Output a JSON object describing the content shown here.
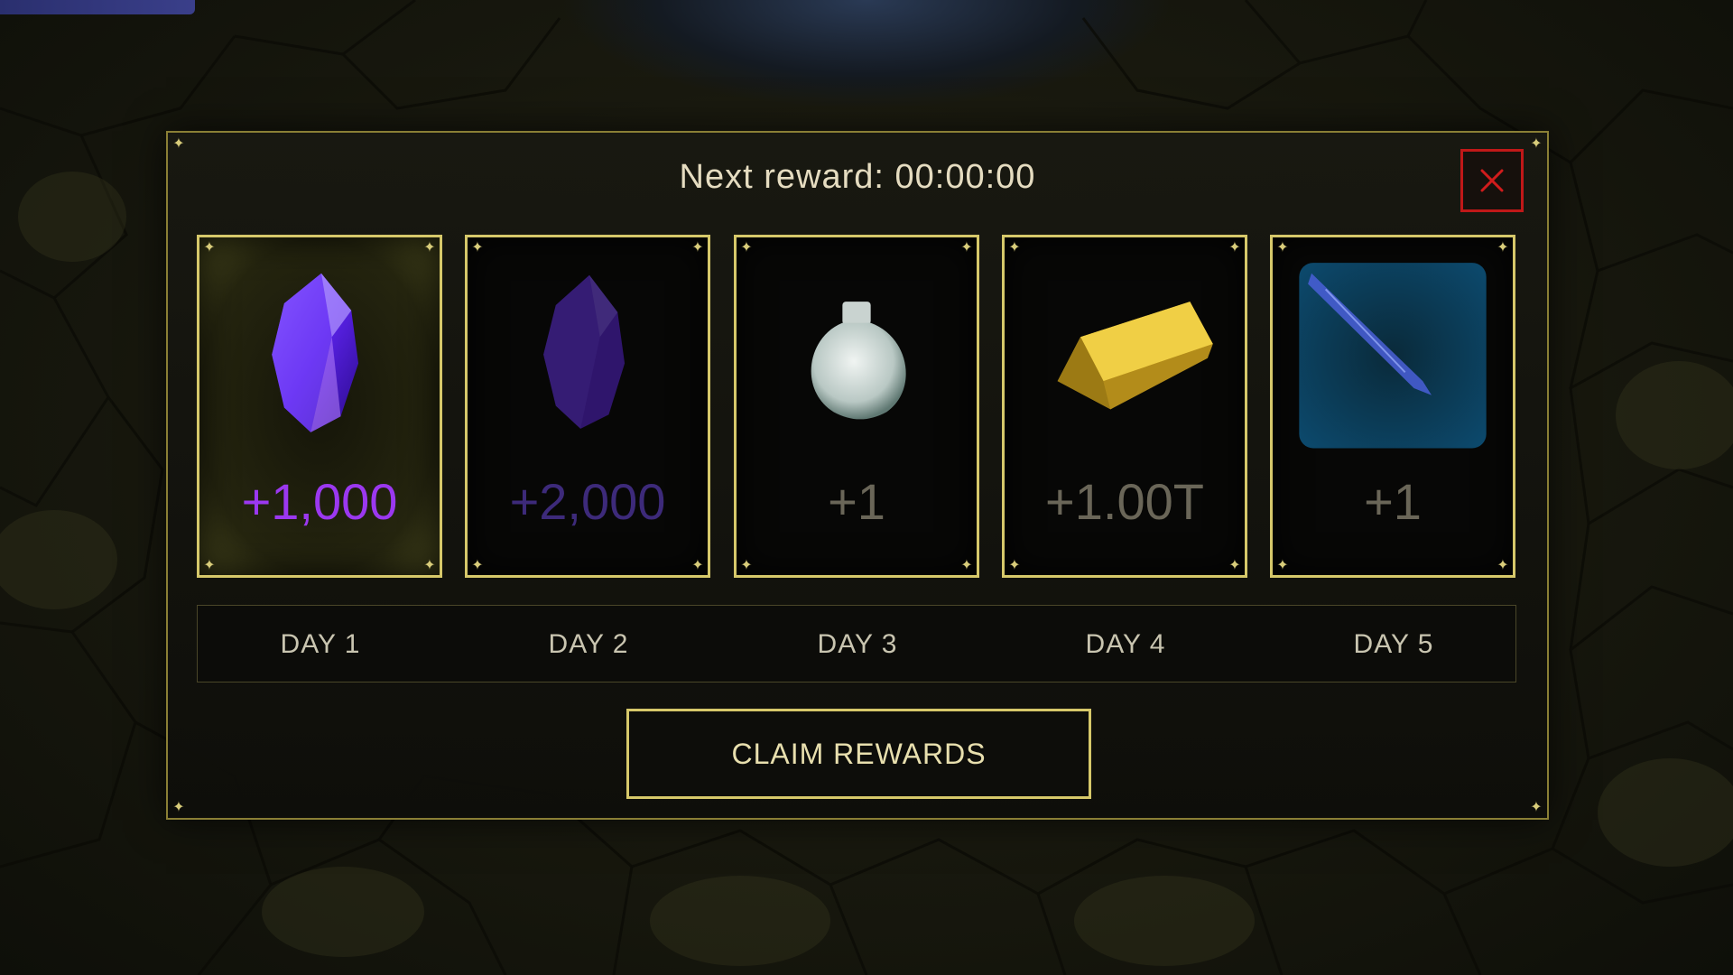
{
  "header": {
    "title": "Next reward: 00:00:00"
  },
  "close": {
    "icon": "close-x-icon",
    "color": "#c01818"
  },
  "rewards": [
    {
      "day": "DAY 1",
      "amount": "+1,000",
      "icon": "purple-crystal-icon",
      "state": "active"
    },
    {
      "day": "DAY 2",
      "amount": "+2,000",
      "icon": "purple-crystal-icon",
      "state": "locked"
    },
    {
      "day": "DAY 3",
      "amount": "+1",
      "icon": "potion-flask-icon",
      "state": "locked"
    },
    {
      "day": "DAY 4",
      "amount": "+1.00T",
      "icon": "gold-bar-icon",
      "state": "locked"
    },
    {
      "day": "DAY 5",
      "amount": "+1",
      "icon": "blue-blade-icon",
      "state": "locked"
    }
  ],
  "claim": {
    "label": "CLAIM REWARDS"
  },
  "colors": {
    "frame": "#d6c86a",
    "gem_active": "#9b38f0",
    "text": "#e5dcc0"
  }
}
